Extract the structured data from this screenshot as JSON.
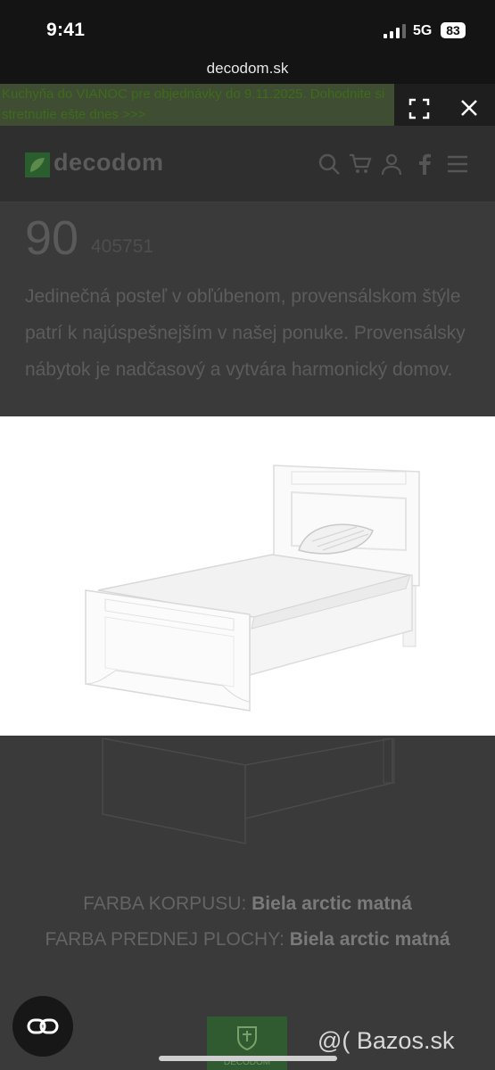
{
  "status": {
    "time": "9:41",
    "network": "5G",
    "battery": "83"
  },
  "browser": {
    "url": "decodom.sk"
  },
  "promo": {
    "text": "Kuchyňa do VIANOC pre objednávky do 9.11.2025. Dohodnite si stretnutie ešte dnes >>>"
  },
  "video_controls": {
    "expand_icon": "expand-icon",
    "close_icon": "close-icon"
  },
  "header": {
    "logo_text": "decodom",
    "icons": [
      "search-icon",
      "cart-icon",
      "user-icon",
      "facebook-icon",
      "menu-icon"
    ]
  },
  "product": {
    "code": "90",
    "id": "405751",
    "description": "Jedinečná posteľ v obľúbenom, provensálskom štýle patrí k najúspešnejším v našej ponuke. Provensálsky nábytok je nadčasový a vytvára harmonický domov."
  },
  "attributes": {
    "body_color_label": "FARBA KORPUSU:",
    "body_color_value": "Biela arctic matná",
    "front_color_label": "FARBA PREDNEJ PLOCHY:",
    "front_color_value": "Biela arctic matná"
  },
  "badge": {
    "label": "DECODOM"
  },
  "watermark": {
    "text": "@( Bazos.sk"
  },
  "colors": {
    "promo_bg": "#3f4d32",
    "brand_green": "#2a5e2e",
    "overlay": "#3a3a3a"
  }
}
